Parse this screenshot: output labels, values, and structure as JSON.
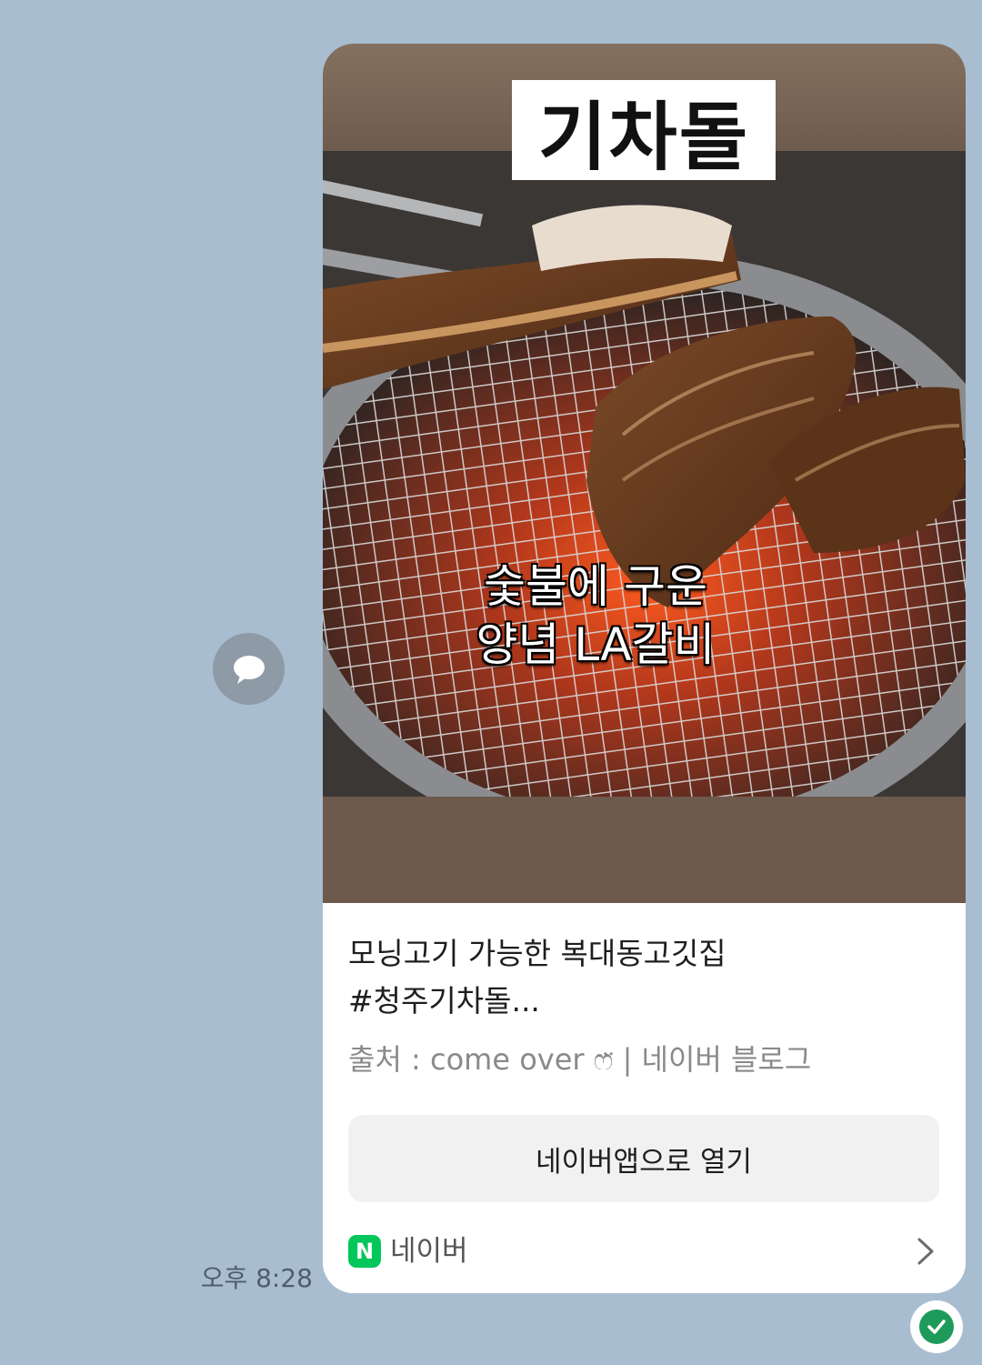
{
  "message": {
    "thumbnail": {
      "overlay_title": "기차돌",
      "overlay_caption_lines": [
        "숯불에 구운",
        "양념 LA갈비"
      ]
    },
    "title_lines": [
      "모닝고기 가능한 복대동고깃집",
      " #청주기차돌..."
    ],
    "source": "출처 : come over ෆ̈ | 네이버 블로그",
    "open_button_label": "네이버앱으로 열기",
    "footer_label": "네이버",
    "footer_logo_letter": "N",
    "timestamp": "오후 8:28"
  },
  "icons": {
    "share": "speech-bubble-icon",
    "footer_arrow": "chevron-right-icon",
    "read_status": "check-circle-icon",
    "brand": "naver-logo-icon"
  },
  "colors": {
    "chat_background": "#a9bdd1",
    "naver_green": "#03c75a",
    "read_check": "#1e9b5a"
  }
}
